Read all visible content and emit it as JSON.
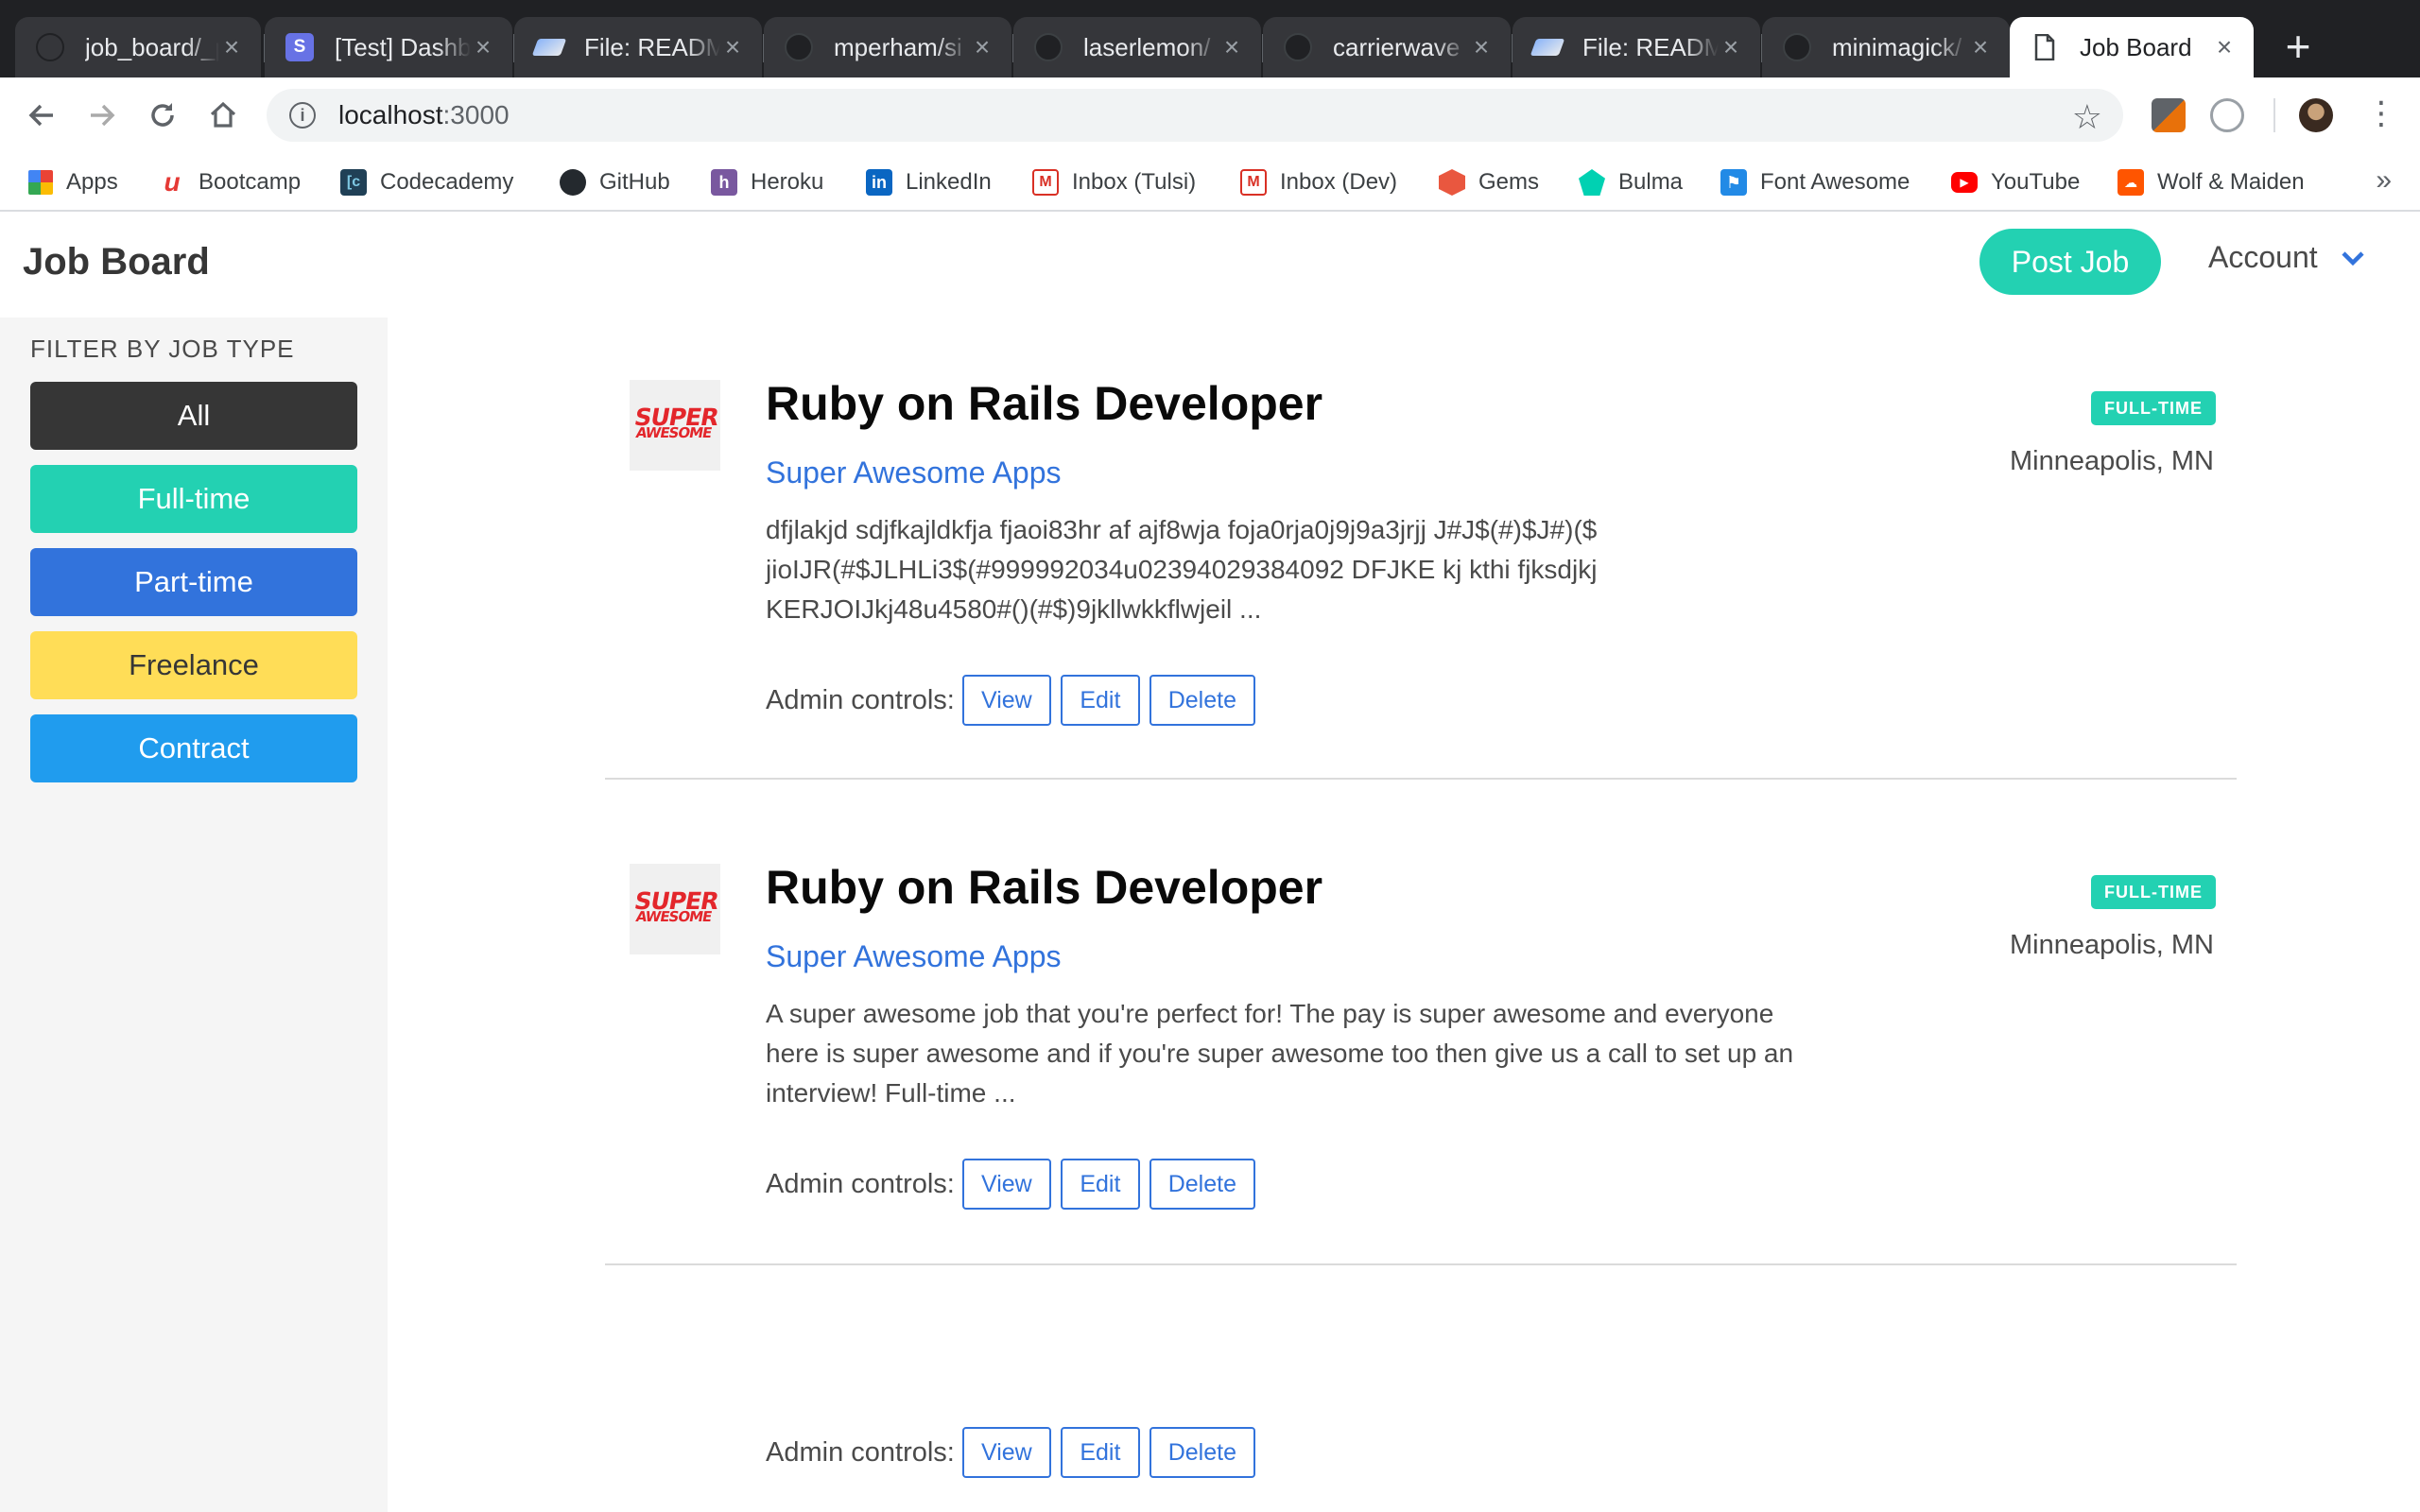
{
  "browser": {
    "tabs": [
      {
        "title": "job_board/_p",
        "icon": "github-icon"
      },
      {
        "title": "[Test] Dashb",
        "icon": "stripe-icon"
      },
      {
        "title": "File: READM",
        "icon": "rubydoc-icon"
      },
      {
        "title": "mperham/si",
        "icon": "github-icon"
      },
      {
        "title": "laserlemon/",
        "icon": "github-icon"
      },
      {
        "title": "carrierwave",
        "icon": "github-icon"
      },
      {
        "title": "File: READM",
        "icon": "rubydoc-icon"
      },
      {
        "title": "minimagick/",
        "icon": "github-icon"
      },
      {
        "title": "Job Board",
        "icon": "page-icon",
        "active": true
      }
    ],
    "url_host": "localhost",
    "url_port": ":3000",
    "bookmarks": [
      "Apps",
      "Bootcamp",
      "Codecademy",
      "GitHub",
      "Heroku",
      "LinkedIn",
      "Inbox (Tulsi)",
      "Inbox (Dev)",
      "Gems",
      "Bulma",
      "Font Awesome",
      "YouTube",
      "Wolf & Maiden"
    ],
    "bookmarks_more": "»"
  },
  "header": {
    "brand": "Job Board",
    "post_job": "Post Job",
    "account": "Account"
  },
  "sidebar": {
    "heading": "FILTER BY JOB TYPE",
    "filters": [
      {
        "label": "All",
        "color": "#363636"
      },
      {
        "label": "Full-time",
        "color": "#23d1b2"
      },
      {
        "label": "Part-time",
        "color": "#3273dc"
      },
      {
        "label": "Freelance",
        "color": "#ffdd57"
      },
      {
        "label": "Contract",
        "color": "#209cee"
      }
    ]
  },
  "jobs": [
    {
      "title": "Ruby on Rails Developer",
      "company": "Super Awesome Apps",
      "logo_text_1": "SUPER",
      "logo_text_2": "AWESOME",
      "description": "dfjlakjd sdjfkajldkfja fjaoi83hr af ajf8wja foja0rja0j9j9a3jrjj J#J$(#)$J#)($ jioIJR(#$JLHLi3$(#999992034u02394029384092 DFJKE kj kthi fjksdjkj KERJOIJkj48u4580#()(#$)9jkllwkkflwjeil ...",
      "type_badge": "FULL-TIME",
      "location": "Minneapolis, MN"
    },
    {
      "title": "Ruby on Rails Developer",
      "company": "Super Awesome Apps",
      "logo_text_1": "SUPER",
      "logo_text_2": "AWESOME",
      "description": "A super awesome job that you're perfect for! The pay is super awesome and everyone here is super awesome and if you're super awesome too then give us a call to set up an interview! Full-time ...",
      "type_badge": "FULL-TIME",
      "location": "Minneapolis, MN"
    }
  ],
  "admin": {
    "label": "Admin controls:",
    "view": "View",
    "edit": "Edit",
    "delete": "Delete"
  },
  "colors": {
    "primary": "#23d1b2",
    "link": "#3273dc"
  }
}
